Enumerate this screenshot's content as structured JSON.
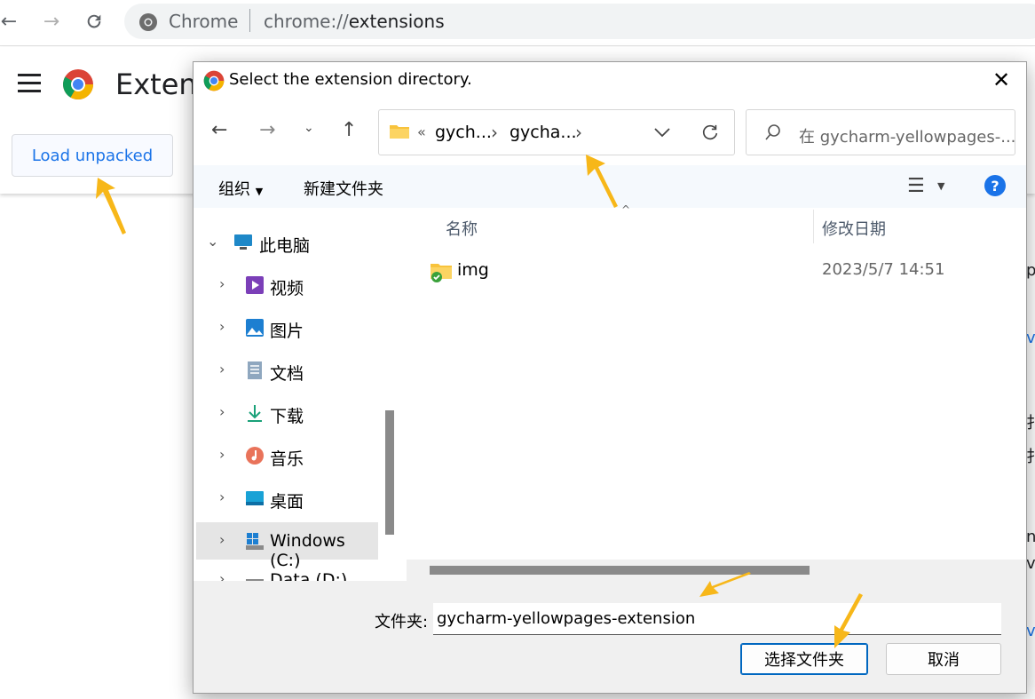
{
  "browser": {
    "back_icon": "arrow-left-icon",
    "forward_icon": "arrow-right-icon",
    "reload_icon": "reload-icon",
    "site_name": "Chrome",
    "url_scheme": "chrome://",
    "url_path": "extensions"
  },
  "extensions_page": {
    "title": "Extens",
    "load_unpacked_label": "Load unpacked"
  },
  "dialog": {
    "title": "Select the extension directory.",
    "breadcrumb": {
      "overflow": "«",
      "segments": [
        "gych...",
        "gycha..."
      ],
      "separator": "›"
    },
    "search_placeholder": "在 gycharm-yellowpages-...",
    "toolbar": {
      "organize": "组织",
      "new_folder": "新建文件夹"
    },
    "tree": [
      {
        "label": "此电脑",
        "icon": "computer-icon",
        "expanded": true
      },
      {
        "label": "视频",
        "icon": "video-icon"
      },
      {
        "label": "图片",
        "icon": "picture-icon"
      },
      {
        "label": "文档",
        "icon": "document-icon"
      },
      {
        "label": "下载",
        "icon": "download-icon"
      },
      {
        "label": "音乐",
        "icon": "music-icon"
      },
      {
        "label": "桌面",
        "icon": "desktop-icon"
      },
      {
        "label": "Windows (C:)",
        "icon": "drive-icon",
        "selected": true
      },
      {
        "label": "Data (D:)",
        "icon": "drive-icon"
      }
    ],
    "columns": {
      "name": "名称",
      "modified": "修改日期"
    },
    "files": [
      {
        "name": "img",
        "modified": "2023/5/7 14:51",
        "icon": "folder-synced-icon"
      }
    ],
    "folder_label": "文件夹:",
    "folder_value": "gycharm-yellowpages-extension",
    "select_button": "选择文件夹",
    "cancel_button": "取消",
    "help_label": "?"
  },
  "page_fragments": [
    "p",
    "vi",
    "扌",
    "扌",
    "n",
    "vi",
    "vi"
  ],
  "colors": {
    "accent": "#1a73e8",
    "annotation_arrow": "#f7b719",
    "dialog_focus": "#0067c0"
  }
}
